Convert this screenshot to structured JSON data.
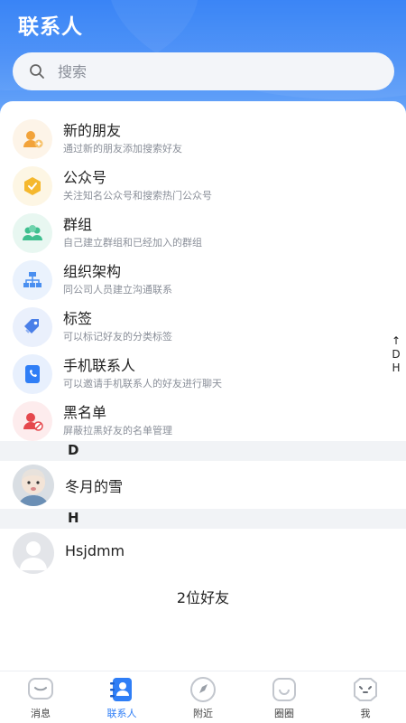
{
  "header": {
    "title": "联系人"
  },
  "search": {
    "placeholder": "搜索"
  },
  "functions": [
    {
      "title": "新的朋友",
      "subtitle": "通过新的朋友添加搜索好友",
      "icon": "new-friend-icon",
      "color": "#f2a33a"
    },
    {
      "title": "公众号",
      "subtitle": "关注知名公众号和搜索热门公众号",
      "icon": "official-account-icon",
      "color": "#f5b82e"
    },
    {
      "title": "群组",
      "subtitle": "自己建立群组和已经加入的群组",
      "icon": "group-icon",
      "color": "#3fbf8f"
    },
    {
      "title": "组织架构",
      "subtitle": "同公司人员建立沟通联系",
      "icon": "org-structure-icon",
      "color": "#4a8ff0"
    },
    {
      "title": "标签",
      "subtitle": "可以标记好友的分类标签",
      "icon": "tag-icon",
      "color": "#4a7fe8"
    },
    {
      "title": "手机联系人",
      "subtitle": "可以邀请手机联系人的好友进行聊天",
      "icon": "phone-contact-icon",
      "color": "#2f7ef6"
    },
    {
      "title": "黑名单",
      "subtitle": "屏蔽拉黑好友的名单管理",
      "icon": "blacklist-icon",
      "color": "#e5484d"
    }
  ],
  "sections": [
    {
      "letter": "D",
      "friends": [
        {
          "name": "冬月的雪",
          "avatar": "photo-avatar"
        }
      ]
    },
    {
      "letter": "H",
      "friends": [
        {
          "name": "Hsjdmm",
          "avatar": "default-avatar"
        }
      ]
    }
  ],
  "friend_count": "2位好友",
  "alpha_index": [
    "↑",
    "D",
    "H"
  ],
  "tabs": [
    {
      "label": "消息",
      "icon": "message-icon",
      "active": false
    },
    {
      "label": "联系人",
      "icon": "contacts-icon",
      "active": true
    },
    {
      "label": "附近",
      "icon": "nearby-icon",
      "active": false
    },
    {
      "label": "圈圈",
      "icon": "moments-icon",
      "active": false
    },
    {
      "label": "我",
      "icon": "me-icon",
      "active": false
    }
  ],
  "colors": {
    "primary": "#2f7ef6",
    "tab_inactive": "#c2c6cd"
  }
}
